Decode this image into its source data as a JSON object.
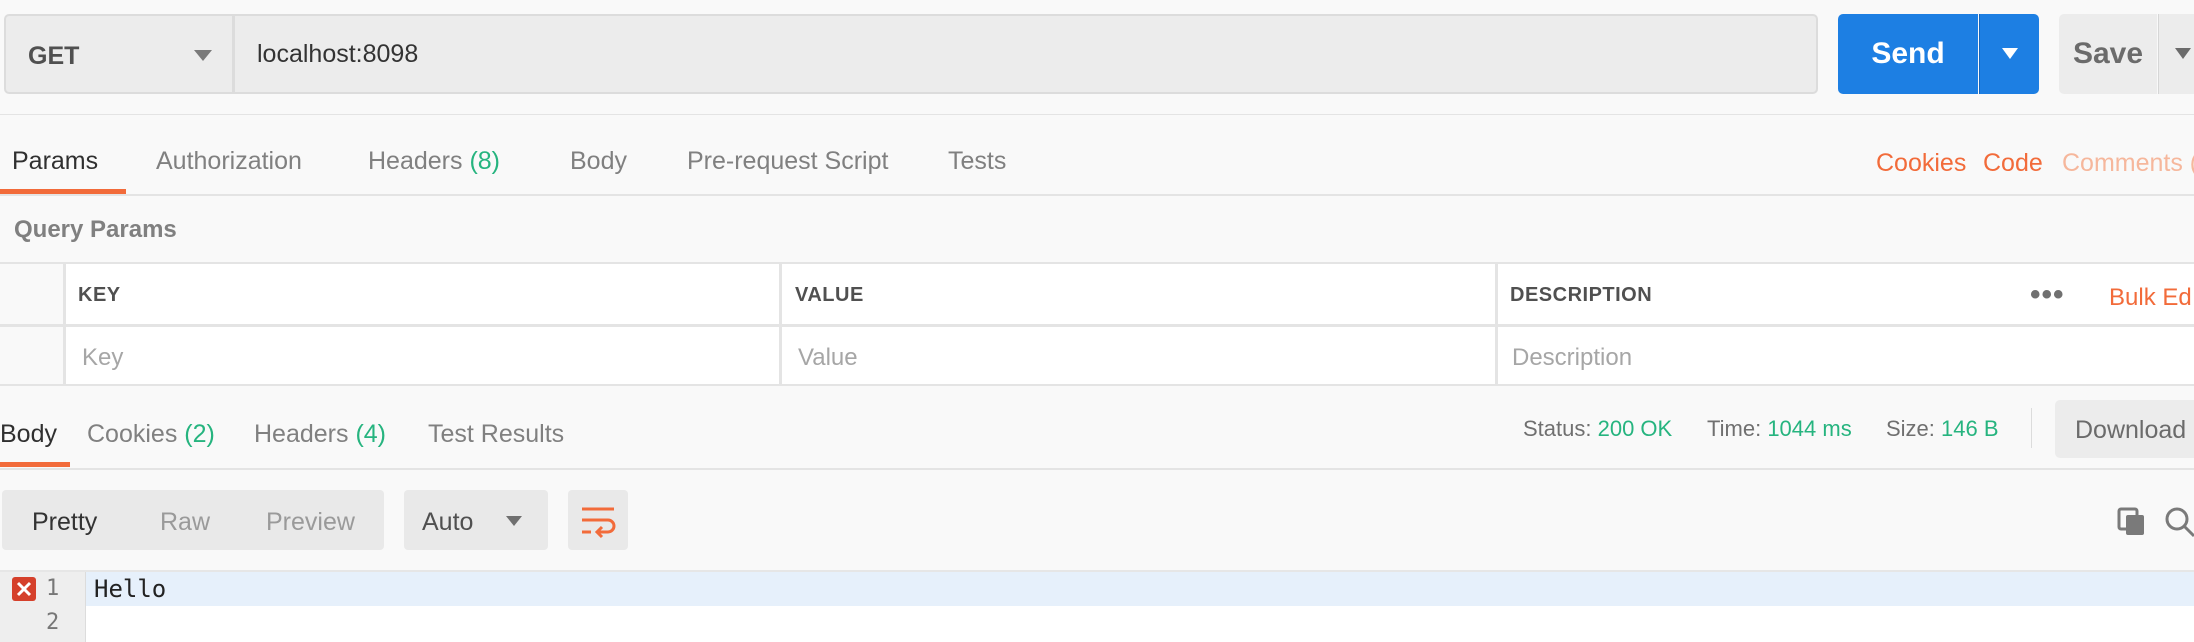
{
  "request": {
    "method": "GET",
    "url": "localhost:8098",
    "send_label": "Send",
    "save_label": "Save"
  },
  "request_tabs": {
    "params": "Params",
    "authorization": "Authorization",
    "headers": "Headers",
    "headers_count": "(8)",
    "body": "Body",
    "pre_request": "Pre-request Script",
    "tests": "Tests",
    "cookies_link": "Cookies",
    "code_link": "Code",
    "comments_link": "Comments ("
  },
  "query_params": {
    "title": "Query Params",
    "columns": [
      "KEY",
      "VALUE",
      "DESCRIPTION"
    ],
    "placeholders": [
      "Key",
      "Value",
      "Description"
    ],
    "bulk_edit": "Bulk Ed"
  },
  "response_tabs": {
    "body": "Body",
    "cookies": "Cookies",
    "cookies_count": "(2)",
    "headers": "Headers",
    "headers_count": "(4)",
    "test_results": "Test Results"
  },
  "response_status": {
    "status_label": "Status:",
    "status_value": "200 OK",
    "time_label": "Time:",
    "time_value": "1044 ms",
    "size_label": "Size:",
    "size_value": "146 B",
    "download_label": "Download"
  },
  "response_view": {
    "modes": [
      "Pretty",
      "Raw",
      "Preview"
    ],
    "active_mode": "Pretty",
    "format": "Auto"
  },
  "response_body": {
    "lines": [
      {
        "num": "1",
        "text": "Hello"
      },
      {
        "num": "2",
        "text": ""
      }
    ]
  },
  "colors": {
    "accent_orange": "#f26b3a",
    "send_blue": "#1d7fe3",
    "count_green": "#26b47f",
    "error_red": "#d5402b"
  },
  "icons": [
    "chevron-down-icon",
    "more-dots-icon",
    "wrap-lines-icon",
    "copy-icon",
    "search-icon",
    "error-icon"
  ]
}
